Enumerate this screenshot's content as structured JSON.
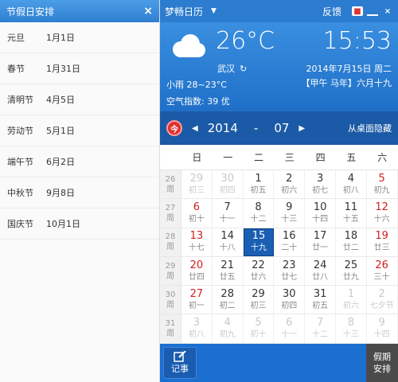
{
  "holiday_panel": {
    "title": "节假日安排",
    "close": "×",
    "items": [
      {
        "name": "元旦",
        "date": "1月1日"
      },
      {
        "name": "春节",
        "date": "1月31日"
      },
      {
        "name": "清明节",
        "date": "4月5日"
      },
      {
        "name": "劳动节",
        "date": "5月1日"
      },
      {
        "name": "端午节",
        "date": "6月2日"
      },
      {
        "name": "中秋节",
        "date": "9月8日"
      },
      {
        "name": "国庆节",
        "date": "10月1日"
      }
    ]
  },
  "topbar": {
    "app_name": "梦畅日历",
    "menu_caret": "▼",
    "feedback": "反馈",
    "gift_icon": "gift-icon",
    "minimize_icon": "minimize-icon",
    "close": "×"
  },
  "weather": {
    "temperature": "26°C",
    "city": "武汉",
    "refresh": "↻",
    "condition": "小雨 28~23°C",
    "aqi": "空气指数: 39 优"
  },
  "clock": {
    "time": "15:53",
    "date": "2014年7月15日 周二",
    "lunar": "【甲午 马年】六月十九"
  },
  "nav": {
    "today_label": "今",
    "prev": "◀",
    "year": "2014",
    "dash": "-",
    "month": "07",
    "next": "▶",
    "hide": "从桌面隐藏"
  },
  "calendar": {
    "weekdays": [
      "日",
      "一",
      "二",
      "三",
      "四",
      "五",
      "六"
    ],
    "weeks": [
      {
        "num": "26",
        "label": "周",
        "days": [
          {
            "d": "29",
            "l": "初三",
            "cls": "faded"
          },
          {
            "d": "30",
            "l": "初四",
            "cls": "faded"
          },
          {
            "d": "1",
            "l": "初五",
            "cls": ""
          },
          {
            "d": "2",
            "l": "初六",
            "cls": ""
          },
          {
            "d": "3",
            "l": "初七",
            "cls": ""
          },
          {
            "d": "4",
            "l": "初八",
            "cls": ""
          },
          {
            "d": "5",
            "l": "初九",
            "cls": "we"
          }
        ]
      },
      {
        "num": "27",
        "label": "周",
        "days": [
          {
            "d": "6",
            "l": "初十",
            "cls": "we"
          },
          {
            "d": "7",
            "l": "十一",
            "cls": ""
          },
          {
            "d": "8",
            "l": "十二",
            "cls": ""
          },
          {
            "d": "9",
            "l": "十三",
            "cls": ""
          },
          {
            "d": "10",
            "l": "十四",
            "cls": ""
          },
          {
            "d": "11",
            "l": "十五",
            "cls": ""
          },
          {
            "d": "12",
            "l": "十六",
            "cls": "we"
          }
        ]
      },
      {
        "num": "28",
        "label": "周",
        "days": [
          {
            "d": "13",
            "l": "十七",
            "cls": "we"
          },
          {
            "d": "14",
            "l": "十八",
            "cls": ""
          },
          {
            "d": "15",
            "l": "十九",
            "cls": "today"
          },
          {
            "d": "16",
            "l": "二十",
            "cls": ""
          },
          {
            "d": "17",
            "l": "廿一",
            "cls": ""
          },
          {
            "d": "18",
            "l": "廿二",
            "cls": ""
          },
          {
            "d": "19",
            "l": "廿三",
            "cls": "we"
          }
        ]
      },
      {
        "num": "29",
        "label": "周",
        "days": [
          {
            "d": "20",
            "l": "廿四",
            "cls": "we"
          },
          {
            "d": "21",
            "l": "廿五",
            "cls": ""
          },
          {
            "d": "22",
            "l": "廿六",
            "cls": ""
          },
          {
            "d": "23",
            "l": "廿七",
            "cls": ""
          },
          {
            "d": "24",
            "l": "廿八",
            "cls": ""
          },
          {
            "d": "25",
            "l": "廿九",
            "cls": ""
          },
          {
            "d": "26",
            "l": "三十",
            "cls": "we"
          }
        ]
      },
      {
        "num": "30",
        "label": "周",
        "days": [
          {
            "d": "27",
            "l": "初一",
            "cls": "we"
          },
          {
            "d": "28",
            "l": "初二",
            "cls": ""
          },
          {
            "d": "29",
            "l": "初三",
            "cls": ""
          },
          {
            "d": "30",
            "l": "初四",
            "cls": ""
          },
          {
            "d": "31",
            "l": "初五",
            "cls": ""
          },
          {
            "d": "1",
            "l": "初六",
            "cls": "faded"
          },
          {
            "d": "2",
            "l": "七夕节",
            "cls": "faded"
          }
        ]
      },
      {
        "num": "31",
        "label": "周",
        "days": [
          {
            "d": "3",
            "l": "初八",
            "cls": "faded"
          },
          {
            "d": "4",
            "l": "初九",
            "cls": "faded"
          },
          {
            "d": "5",
            "l": "初十",
            "cls": "faded"
          },
          {
            "d": "6",
            "l": "十一",
            "cls": "faded"
          },
          {
            "d": "7",
            "l": "十二",
            "cls": "faded"
          },
          {
            "d": "8",
            "l": "十三",
            "cls": "faded"
          },
          {
            "d": "9",
            "l": "十四",
            "cls": "faded"
          }
        ]
      }
    ]
  },
  "bottom": {
    "note_label": "记事",
    "holiday_line1": "假期",
    "holiday_line2": "安排"
  }
}
